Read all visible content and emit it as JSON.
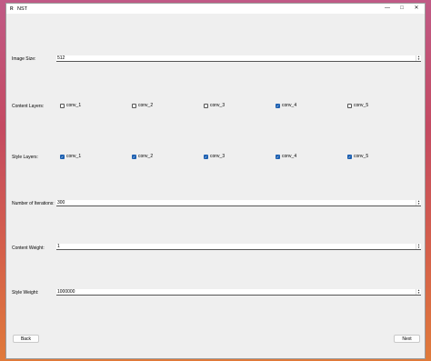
{
  "window": {
    "title": "NST",
    "icon_text": "R"
  },
  "fields": {
    "image_size": {
      "label": "Image Size:",
      "value": "512"
    },
    "iterations": {
      "label": "Number of Iterations:",
      "value": "300"
    },
    "content_weight": {
      "label": "Content Weight:",
      "value": "1"
    },
    "style_weight": {
      "label": "Style Weight:",
      "value": "1000000"
    }
  },
  "content_layers": {
    "label": "Content Layers:",
    "items": [
      {
        "label": "conv_1",
        "checked": false
      },
      {
        "label": "conv_2",
        "checked": false
      },
      {
        "label": "conv_3",
        "checked": false
      },
      {
        "label": "conv_4",
        "checked": true
      },
      {
        "label": "conv_5",
        "checked": false
      }
    ]
  },
  "style_layers": {
    "label": "Style Layers:",
    "items": [
      {
        "label": "conv_1",
        "checked": true
      },
      {
        "label": "conv_2",
        "checked": true
      },
      {
        "label": "conv_3",
        "checked": true
      },
      {
        "label": "conv_4",
        "checked": true
      },
      {
        "label": "conv_5",
        "checked": true
      }
    ]
  },
  "buttons": {
    "back": "Back",
    "next": "Next"
  },
  "colors": {
    "accent": "#1c5fb0"
  }
}
